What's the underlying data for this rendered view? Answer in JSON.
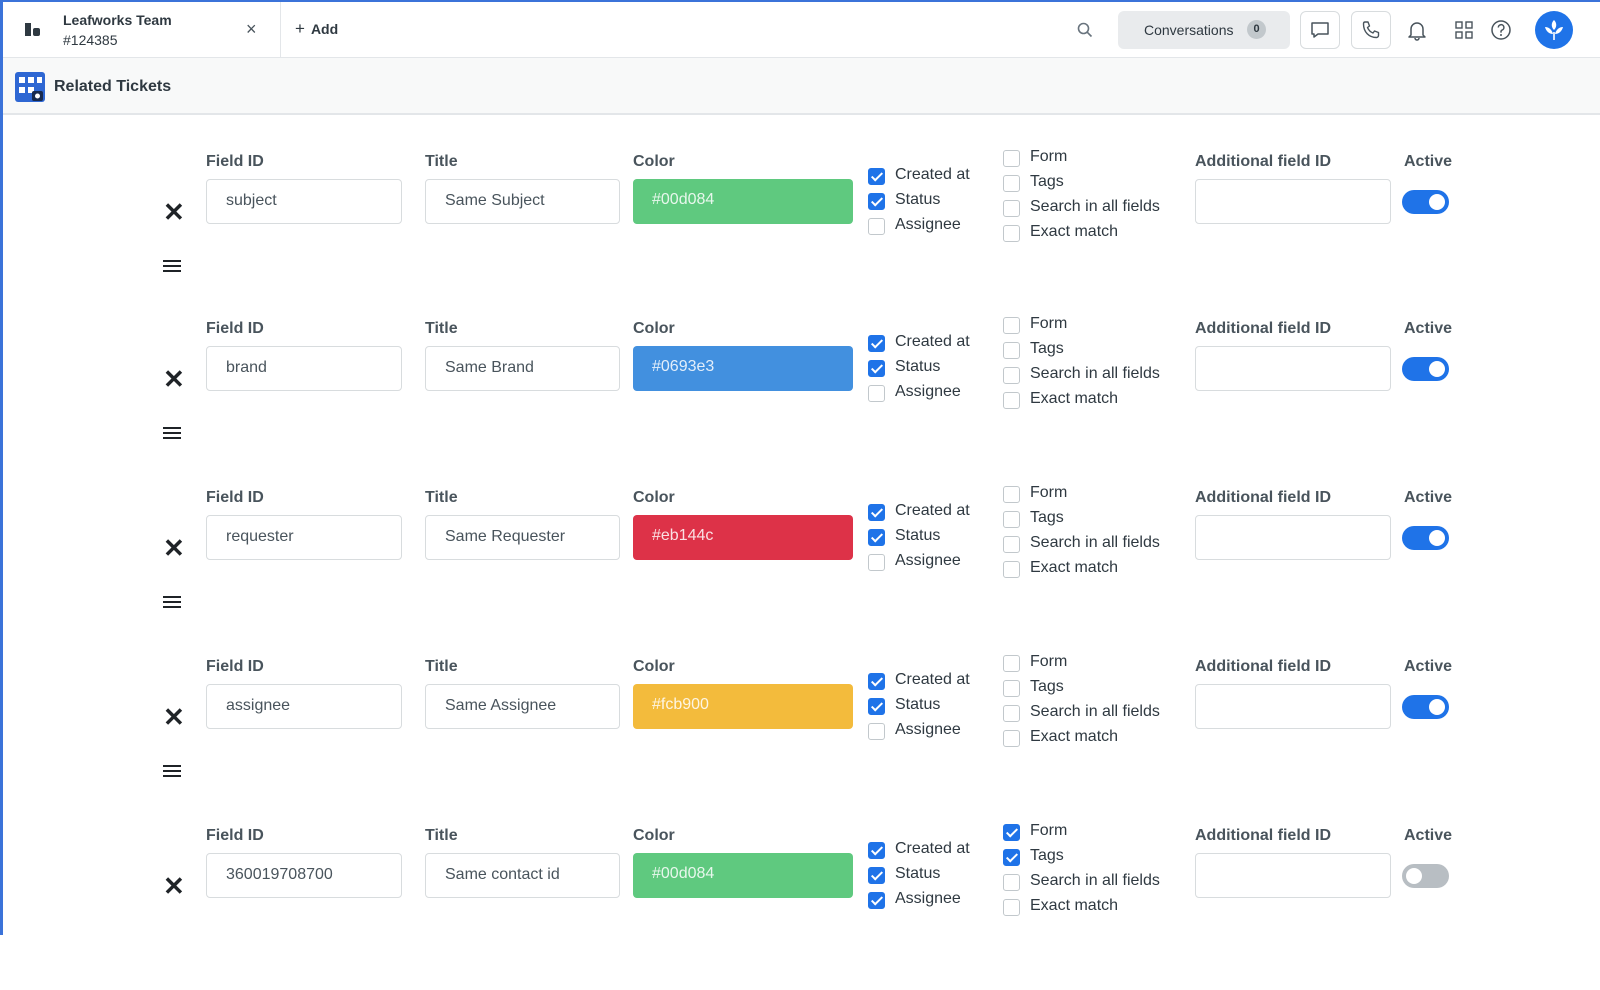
{
  "topbar": {
    "tab_title": "Leafworks Team",
    "tab_subtitle": "#124385",
    "close_glyph": "×",
    "add_label": "Add",
    "conversations_label": "Conversations",
    "conversations_count": "0",
    "icons": [
      "search-icon",
      "chat-icon",
      "phone-icon",
      "bell-icon",
      "apps-grid-icon",
      "help-icon"
    ]
  },
  "app": {
    "title": "Related Tickets"
  },
  "labels": {
    "field_id": "Field ID",
    "title": "Title",
    "color": "Color",
    "created_at": "Created at",
    "status": "Status",
    "assignee": "Assignee",
    "form": "Form",
    "tags": "Tags",
    "search_all": "Search in all fields",
    "exact_match": "Exact match",
    "additional_field_id": "Additional field ID",
    "active": "Active"
  },
  "rows": [
    {
      "field_id": "subject",
      "title": "Same Subject",
      "color": "#00d084",
      "created_at": true,
      "status": true,
      "assignee": false,
      "form": false,
      "tags": false,
      "search_all": false,
      "exact_match": false,
      "additional_field_id": "",
      "active": true
    },
    {
      "field_id": "brand",
      "title": "Same Brand",
      "color": "#0693e3",
      "created_at": true,
      "status": true,
      "assignee": false,
      "form": false,
      "tags": false,
      "search_all": false,
      "exact_match": false,
      "additional_field_id": "",
      "active": true
    },
    {
      "field_id": "requester",
      "title": "Same Requester",
      "color": "#eb144c",
      "created_at": true,
      "status": true,
      "assignee": false,
      "form": false,
      "tags": false,
      "search_all": false,
      "exact_match": false,
      "additional_field_id": "",
      "active": true
    },
    {
      "field_id": "assignee",
      "title": "Same Assignee",
      "color": "#fcb900",
      "created_at": true,
      "status": true,
      "assignee": false,
      "form": false,
      "tags": false,
      "search_all": false,
      "exact_match": false,
      "additional_field_id": "",
      "active": true
    },
    {
      "field_id": "360019708700",
      "title": "Same contact id",
      "color": "#00d084",
      "created_at": true,
      "status": true,
      "assignee": true,
      "form": true,
      "tags": true,
      "search_all": false,
      "exact_match": false,
      "additional_field_id": "",
      "active": false
    }
  ],
  "swatch_display_colors": {
    "#00d084": "#5fc97f",
    "#0693e3": "#4290df",
    "#eb144c": "#dd3248",
    "#fcb900": "#f3bb3c"
  }
}
